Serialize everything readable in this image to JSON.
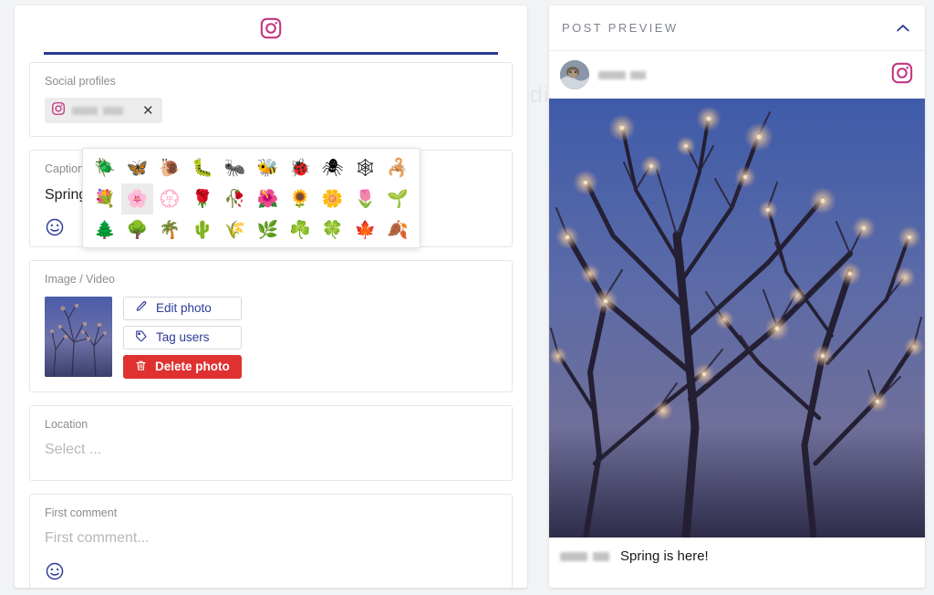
{
  "background": {
    "watermark_text": "ndi"
  },
  "composer": {
    "network_tab": {
      "icon": "instagram-icon",
      "accent_color": "#c13584",
      "underline_color": "#2d3a96"
    },
    "social_profiles": {
      "label": "Social profiles",
      "chips": [
        {
          "icon": "instagram-icon",
          "username_redacted": true,
          "remove_label": "✕"
        }
      ]
    },
    "caption": {
      "label": "Caption",
      "value": "Spring is here!",
      "emoji_button": "smiley-icon"
    },
    "media": {
      "label": "Image / Video",
      "thumbnail_alt": "blossom-tree-thumbnail",
      "buttons": [
        {
          "label": "Edit photo",
          "icon": "pencil-icon",
          "style": "outline"
        },
        {
          "label": "Tag users",
          "icon": "tag-icon",
          "style": "outline"
        },
        {
          "label": "Delete photo",
          "icon": "trash-icon",
          "style": "danger"
        }
      ],
      "danger_color": "#e03131"
    },
    "location": {
      "label": "Location",
      "value": "",
      "placeholder": "Select ..."
    },
    "first_comment": {
      "label": "First comment",
      "value": "",
      "placeholder": "First comment...",
      "emoji_button": "smiley-icon"
    }
  },
  "emoji_picker": {
    "visible": true,
    "hovered_index": 11,
    "rows": [
      [
        {
          "char": "🪲",
          "name": "beetle"
        },
        {
          "char": "🦋",
          "name": "butterfly"
        },
        {
          "char": "🐌",
          "name": "snail"
        },
        {
          "char": "🐛",
          "name": "bug"
        },
        {
          "char": "🐜",
          "name": "ant"
        },
        {
          "char": "🐝",
          "name": "honeybee"
        },
        {
          "char": "🐞",
          "name": "ladybug"
        },
        {
          "char": "🕷",
          "name": "spider"
        },
        {
          "char": "🕸",
          "name": "spider-web"
        },
        {
          "char": "🦂",
          "name": "scorpion"
        }
      ],
      [
        {
          "char": "💐",
          "name": "bouquet"
        },
        {
          "char": "🌸",
          "name": "cherry-blossom"
        },
        {
          "char": "💮",
          "name": "white-flower"
        },
        {
          "char": "🌹",
          "name": "rose"
        },
        {
          "char": "🥀",
          "name": "wilted-flower"
        },
        {
          "char": "🌺",
          "name": "hibiscus"
        },
        {
          "char": "🌻",
          "name": "sunflower"
        },
        {
          "char": "🌼",
          "name": "blossom"
        },
        {
          "char": "🌷",
          "name": "tulip"
        },
        {
          "char": "🌱",
          "name": "seedling"
        }
      ],
      [
        {
          "char": "🌲",
          "name": "evergreen-tree"
        },
        {
          "char": "🌳",
          "name": "deciduous-tree"
        },
        {
          "char": "🌴",
          "name": "palm-tree"
        },
        {
          "char": "🌵",
          "name": "cactus"
        },
        {
          "char": "🌾",
          "name": "ear-of-rice"
        },
        {
          "char": "🌿",
          "name": "herb"
        },
        {
          "char": "☘️",
          "name": "shamrock"
        },
        {
          "char": "🍀",
          "name": "four-leaf-clover"
        },
        {
          "char": "🍁",
          "name": "maple-leaf"
        },
        {
          "char": "🍂",
          "name": "fallen-leaf"
        }
      ]
    ]
  },
  "preview": {
    "title": "POST PREVIEW",
    "collapse_icon": "chevron-up-icon",
    "post": {
      "avatar_alt": "user-avatar",
      "username_redacted": true,
      "network_icon": "instagram-icon",
      "image_alt": "blossoming-tree-against-blue-sky",
      "caption": "Spring is here!"
    }
  }
}
